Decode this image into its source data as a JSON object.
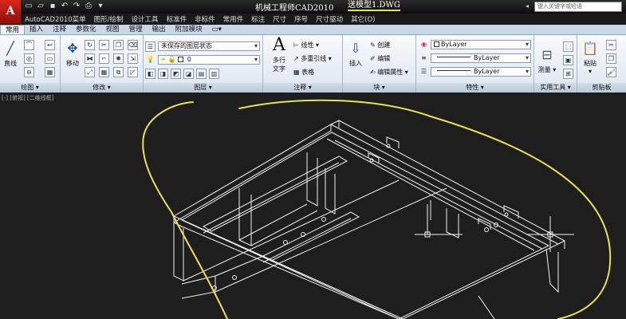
{
  "titlebar": {
    "app_logo": "A",
    "title": "机械工程师CAD2010",
    "file": "送模型1.DWG",
    "search_placeholder": "键入关键字或短语"
  },
  "menubar": [
    "AutoCAD2010菜单",
    "图形/绘制",
    "设计工具",
    "标准件",
    "非标件",
    "常用件",
    "标注",
    "尺寸",
    "序号",
    "尺寸驱动",
    "其它(O)"
  ],
  "tabs": [
    "常用",
    "插入",
    "注释",
    "参数化",
    "视图",
    "管理",
    "输出",
    "附加模块"
  ],
  "active_tab": 0,
  "panels": {
    "draw": {
      "label": "绘图 ▾",
      "line_btn": "直线"
    },
    "modify": {
      "label": "修改 ▾",
      "move_btn": "移动"
    },
    "layers": {
      "label": "图层 ▾",
      "layer_state": "未保存的图层状态",
      "current_layer": "0"
    },
    "annotation": {
      "label": "注释 ▾",
      "mtext_btn_line1": "多行",
      "mtext_btn_line2": "文字",
      "linear": "线性",
      "multileader": "多重引线",
      "table": "表格"
    },
    "block": {
      "label": "块 ▾",
      "insert_btn": "插入",
      "create": "创建",
      "edit": "编辑",
      "edit_attr": "编辑属性"
    },
    "properties": {
      "label": "特性 ▾",
      "color": "ByLayer",
      "linetype": "ByLayer",
      "lineweight": "ByLayer"
    },
    "utilities": {
      "label": "实用工具 ▾",
      "measure_btn": "测量"
    },
    "clipboard": {
      "label": "剪贴板",
      "paste_btn": "粘贴"
    }
  },
  "canvas": {
    "viewport_label": "[-] [俯视] [二维线框]",
    "annotation_color": "#e9e34a"
  }
}
